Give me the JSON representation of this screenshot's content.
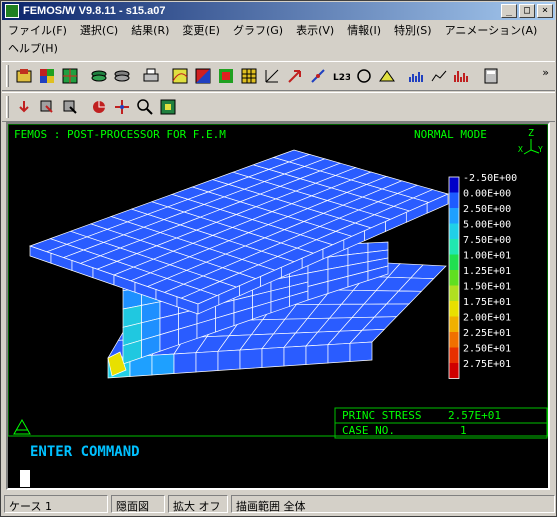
{
  "window": {
    "title": "FEMOS/W V9.8.11 - s15.a07",
    "buttons": [
      "_",
      "□",
      "×"
    ]
  },
  "menu": {
    "row1": [
      "ファイル(F)",
      "選択(C)",
      "結果(R)",
      "変更(E)",
      "グラフ(G)",
      "表示(V)",
      "情報(I)",
      "特別(S)",
      "アニメーション(A)"
    ],
    "row2": [
      "ヘルプ(H)"
    ]
  },
  "toolbar1": {
    "icons": [
      "open-model-icon",
      "element-color-icon",
      "grid-color-icon",
      "layers-icon",
      "layers-alt-icon",
      "print-icon",
      "contour-icon",
      "contour-fill-icon",
      "mesh-color-icon",
      "mesh-grid-icon",
      "axis-icon",
      "vector-arrow-icon",
      "deformation-icon",
      "label-l23-icon",
      "circle-icon",
      "range-icon",
      "bar-graph-icon",
      "line-graph-icon",
      "histogram-icon",
      "calculator-icon"
    ],
    "overflow_label": "»"
  },
  "toolbar2": {
    "icons": [
      "step-down-icon",
      "step-down-all-icon",
      "step-select-icon",
      "rotate-view-icon",
      "pan-view-icon",
      "zoom-view-icon",
      "fit-view-icon"
    ]
  },
  "viewport": {
    "header_left": "FEMOS  :  POST-PROCESSOR  FOR  F.E.M",
    "header_right": "NORMAL MODE",
    "axis_labels": {
      "z": "Z",
      "x": "X",
      "y": "Y"
    },
    "legend": {
      "labels": [
        "-2.50E+00",
        "0.00E+00",
        "2.50E+00",
        "5.00E+00",
        "7.50E+00",
        "1.00E+01",
        "1.25E+01",
        "1.50E+01",
        "1.75E+01",
        "2.00E+01",
        "2.25E+01",
        "2.50E+01",
        "2.75E+01"
      ],
      "colors": [
        "#0000c8",
        "#1e5cff",
        "#1ea0ff",
        "#20d0e8",
        "#20e8b0",
        "#20e050",
        "#60e020",
        "#b0e020",
        "#e8e000",
        "#f0b000",
        "#f07000",
        "#e83000",
        "#d00000"
      ]
    },
    "info": {
      "stress_label": "PRINC STRESS",
      "stress_value": "2.57E+01",
      "case_label": "CASE NO.",
      "case_value": "1"
    },
    "command_prompt": "ENTER  COMMAND",
    "colors": {
      "header_text": "#00ff00",
      "prompt_text": "#00c0ff",
      "mesh_fill": "#2a5cff",
      "mesh_line": "#ffffff"
    }
  },
  "statusbar": {
    "case": "ケース 1",
    "hidden": "隠面図",
    "zoom": "拡大 オフ",
    "range": "描画範囲 全体"
  }
}
